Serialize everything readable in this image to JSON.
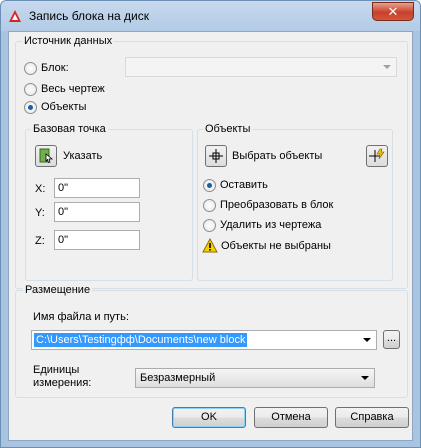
{
  "window": {
    "title": "Запись блока на диск",
    "close_glyph": "✕"
  },
  "source": {
    "legend": "Источник данных",
    "options": [
      {
        "label": "Блок:",
        "checked": false
      },
      {
        "label": "Весь чертеж",
        "checked": false
      },
      {
        "label": "Объекты",
        "checked": true
      }
    ],
    "block_combo_value": ""
  },
  "base_point": {
    "legend": "Базовая точка",
    "pick_label": "Указать",
    "coords": [
      {
        "axis": "X:",
        "value": "0\""
      },
      {
        "axis": "Y:",
        "value": "0\""
      },
      {
        "axis": "Z:",
        "value": "0\""
      }
    ]
  },
  "objects": {
    "legend": "Объекты",
    "select_label": "Выбрать объекты",
    "options": [
      {
        "label": "Оставить",
        "checked": true
      },
      {
        "label": "Преобразовать в блок",
        "checked": false
      },
      {
        "label": "Удалить из чертежа",
        "checked": false
      }
    ],
    "warning": "Объекты не выбраны"
  },
  "placement": {
    "legend": "Размещение",
    "path_label": "Имя файла и путь:",
    "path_value": "C:\\Users\\Testingфф\\Documents\\new block",
    "browse_label": "...",
    "units_label_1": "Единицы",
    "units_label_2": "измерения:",
    "units_value": "Безразмерный"
  },
  "buttons": {
    "ok": "OK",
    "cancel": "Отмена",
    "help": "Справка"
  }
}
